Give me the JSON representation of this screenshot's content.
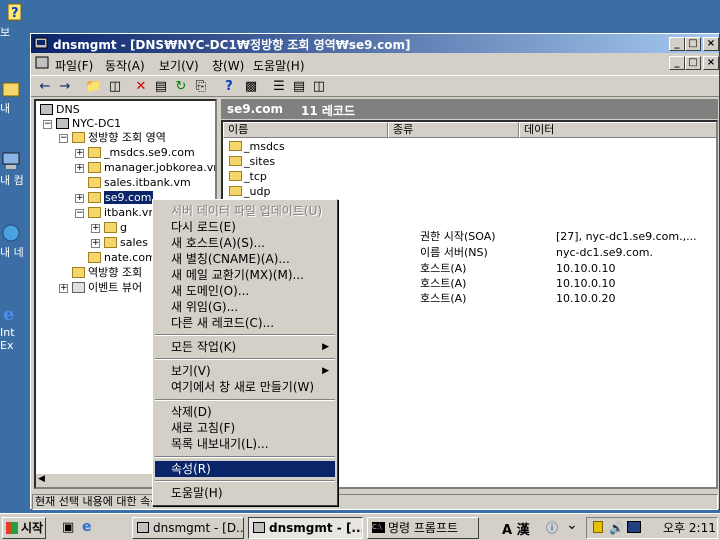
{
  "desktop": {
    "icons": [
      {
        "label": "보",
        "icon": "help-icon"
      },
      {
        "label": "내",
        "icon": "documents-icon"
      },
      {
        "label": "내 컴",
        "icon": "computer-icon"
      },
      {
        "label": "내 네",
        "icon": "network-icon"
      },
      {
        "label": "Int Ex",
        "icon": "ie-icon"
      }
    ]
  },
  "window": {
    "title": "dnsmgmt - [DNS₩NYC-DC1₩정방향 조회 영역₩se9.com]",
    "controls": {
      "minimize": "_",
      "maximize": "□",
      "close": "×"
    }
  },
  "menubar": {
    "items": [
      "파일(F)",
      "동작(A)",
      "보기(V)",
      "창(W)",
      "도움말(H)"
    ]
  },
  "toolbar": {
    "buttons": [
      "back-icon",
      "forward-icon",
      "up-icon",
      "show-tree-icon",
      "delete-icon",
      "properties-icon",
      "refresh-icon",
      "export-icon",
      "help-icon",
      "console-icon",
      "list-icon",
      "detail-icon",
      "filter-icon"
    ]
  },
  "tree": {
    "nodes": [
      {
        "label": "DNS"
      },
      {
        "label": "NYC-DC1"
      },
      {
        "label": "정방향 조회 영역"
      },
      {
        "label": "_msdcs.se9.com"
      },
      {
        "label": "manager.jobkorea.vm"
      },
      {
        "label": "sales.itbank.vm"
      },
      {
        "label": "se9.com"
      },
      {
        "label": "itbank.vm"
      },
      {
        "label": "g"
      },
      {
        "label": "sales"
      },
      {
        "label": "nate.com"
      },
      {
        "label": "역방향 조회"
      },
      {
        "label": "이벤트 뷰어"
      }
    ]
  },
  "list": {
    "header_name": "se9.com",
    "header_count": "11 레코드",
    "columns": [
      "이름",
      "종류",
      "데이터"
    ],
    "rows": [
      {
        "name": "_msdcs",
        "type": "",
        "data": ""
      },
      {
        "name": "_sites",
        "type": "",
        "data": ""
      },
      {
        "name": "_tcp",
        "type": "",
        "data": ""
      },
      {
        "name": "_udp",
        "type": "",
        "data": ""
      },
      {
        "name": "",
        "type": "권한 시작(SOA)",
        "data": "[27], nyc-dc1.se9.com.,..."
      },
      {
        "name": "",
        "type": "이름 서버(NS)",
        "data": "nyc-dc1.se9.com."
      },
      {
        "name": "",
        "type": "호스트(A)",
        "data": "10.10.0.10"
      },
      {
        "name": "",
        "type": "호스트(A)",
        "data": "10.10.0.10"
      },
      {
        "name": "",
        "type": "호스트(A)",
        "data": "10.10.0.20"
      }
    ]
  },
  "status": {
    "text": "현재 선택 내용에 대한 속성"
  },
  "context_menu": {
    "items": [
      {
        "label": "서버 데이터 파일 업데이트(U)"
      },
      {
        "label": "다시 로드(E)"
      },
      {
        "label": "새 호스트(A)(S)..."
      },
      {
        "label": "새 별칭(CNAME)(A)..."
      },
      {
        "label": "새 메일 교환기(MX)(M)..."
      },
      {
        "label": "새 도메인(O)..."
      },
      {
        "label": "새 위임(G)..."
      },
      {
        "label": "다른 새 레코드(C)..."
      },
      {
        "label": "모든 작업(K)"
      },
      {
        "label": "보기(V)"
      },
      {
        "label": "여기에서 창 새로 만들기(W)"
      },
      {
        "label": "삭제(D)"
      },
      {
        "label": "새로 고침(F)"
      },
      {
        "label": "목록 내보내기(L)..."
      },
      {
        "label": "속성(R)"
      },
      {
        "label": "도움말(H)"
      }
    ]
  },
  "taskbar": {
    "start_label": "시작",
    "tasks": [
      {
        "label": "dnsmgmt - [D..."
      },
      {
        "label": "dnsmgmt - [..."
      },
      {
        "label": "명령 프롬프트"
      }
    ],
    "ime": "A 漢",
    "clock": "오후 2:11"
  }
}
